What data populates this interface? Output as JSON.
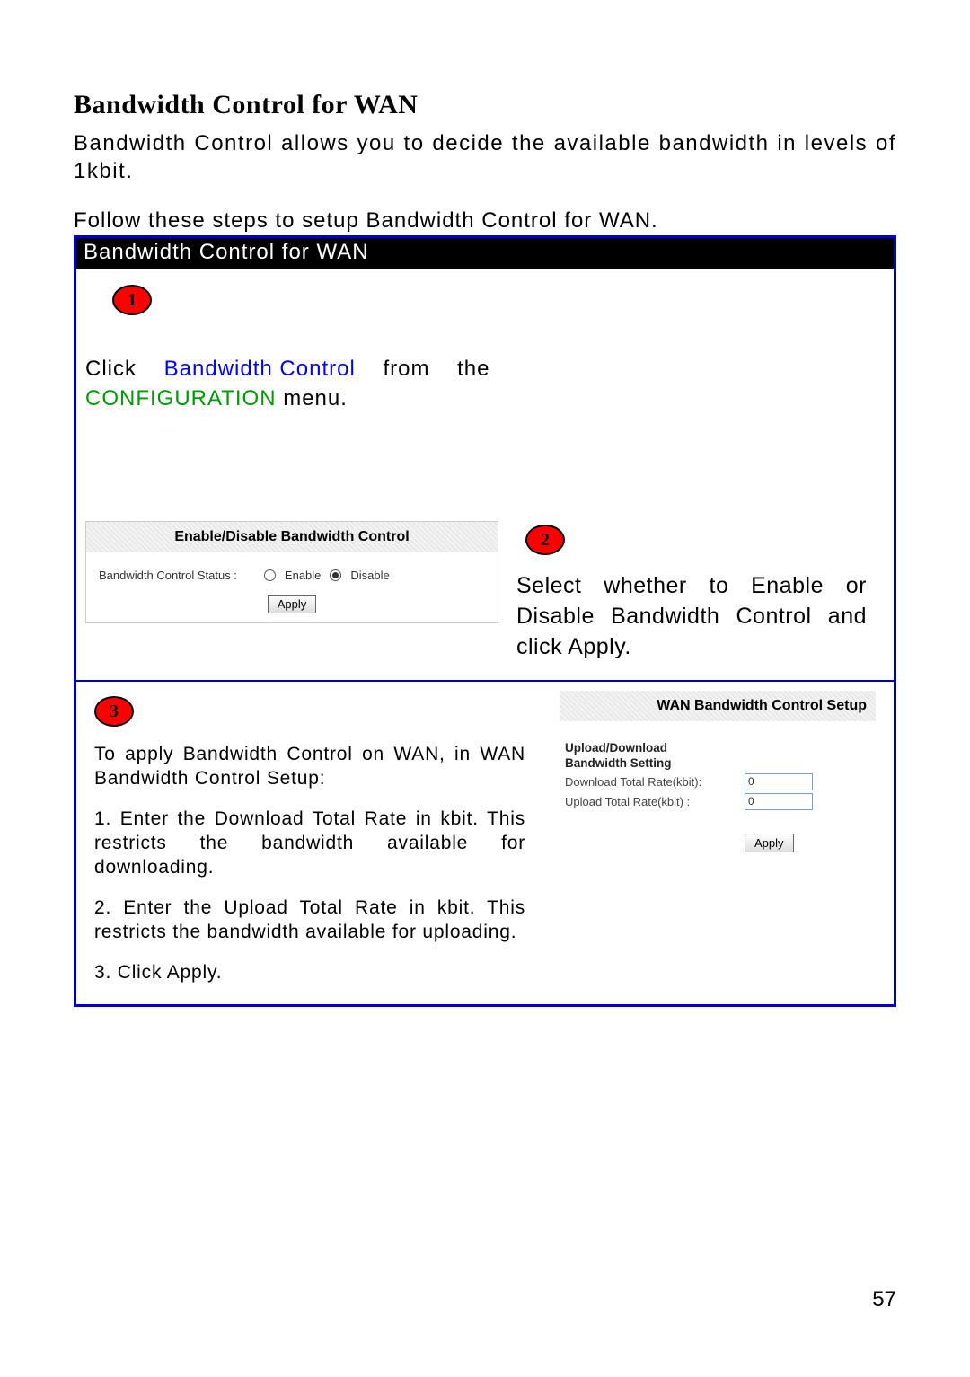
{
  "page_title": "Bandwidth Control for WAN",
  "intro": "Bandwidth Control allows you to decide the available bandwidth in levels of 1kbit.",
  "follow": "Follow these steps to setup Bandwidth Control for WAN.",
  "box_header": "Bandwidth Control for WAN",
  "step1": {
    "badge": "1",
    "click_word": "Click",
    "link_text": "Bandwidth Control",
    "from_word": "from",
    "the_word": "the",
    "menu_text": "CONFIGURATION",
    "menu_suffix": "menu."
  },
  "panel_a": {
    "header": "Enable/Disable Bandwidth Control",
    "status_label": "Bandwidth Control Status :",
    "enable_label": "Enable",
    "disable_label": "Disable",
    "selected": "Disable",
    "apply": "Apply"
  },
  "step2": {
    "badge": "2",
    "text": "Select whether to Enable or Disable Bandwidth Control and click Apply."
  },
  "step3": {
    "badge": "3",
    "p1": "To apply Bandwidth Control on WAN, in WAN Bandwidth Control Setup:",
    "p2": "1. Enter the Download Total Rate in kbit. This restricts the bandwidth available for downloading.",
    "p3": "2. Enter the Upload Total Rate in kbit. This restricts the bandwidth available for uploading.",
    "p4": "3. Click Apply."
  },
  "panel_b": {
    "header": "WAN Bandwidth Control Setup",
    "section_title_l1": "Upload/Download",
    "section_title_l2": "Bandwidth Setting",
    "download_label": "Download Total Rate(kbit):",
    "download_value": "0",
    "upload_label": "Upload Total Rate(kbit) :",
    "upload_value": "0",
    "apply": "Apply"
  },
  "page_number": "57"
}
